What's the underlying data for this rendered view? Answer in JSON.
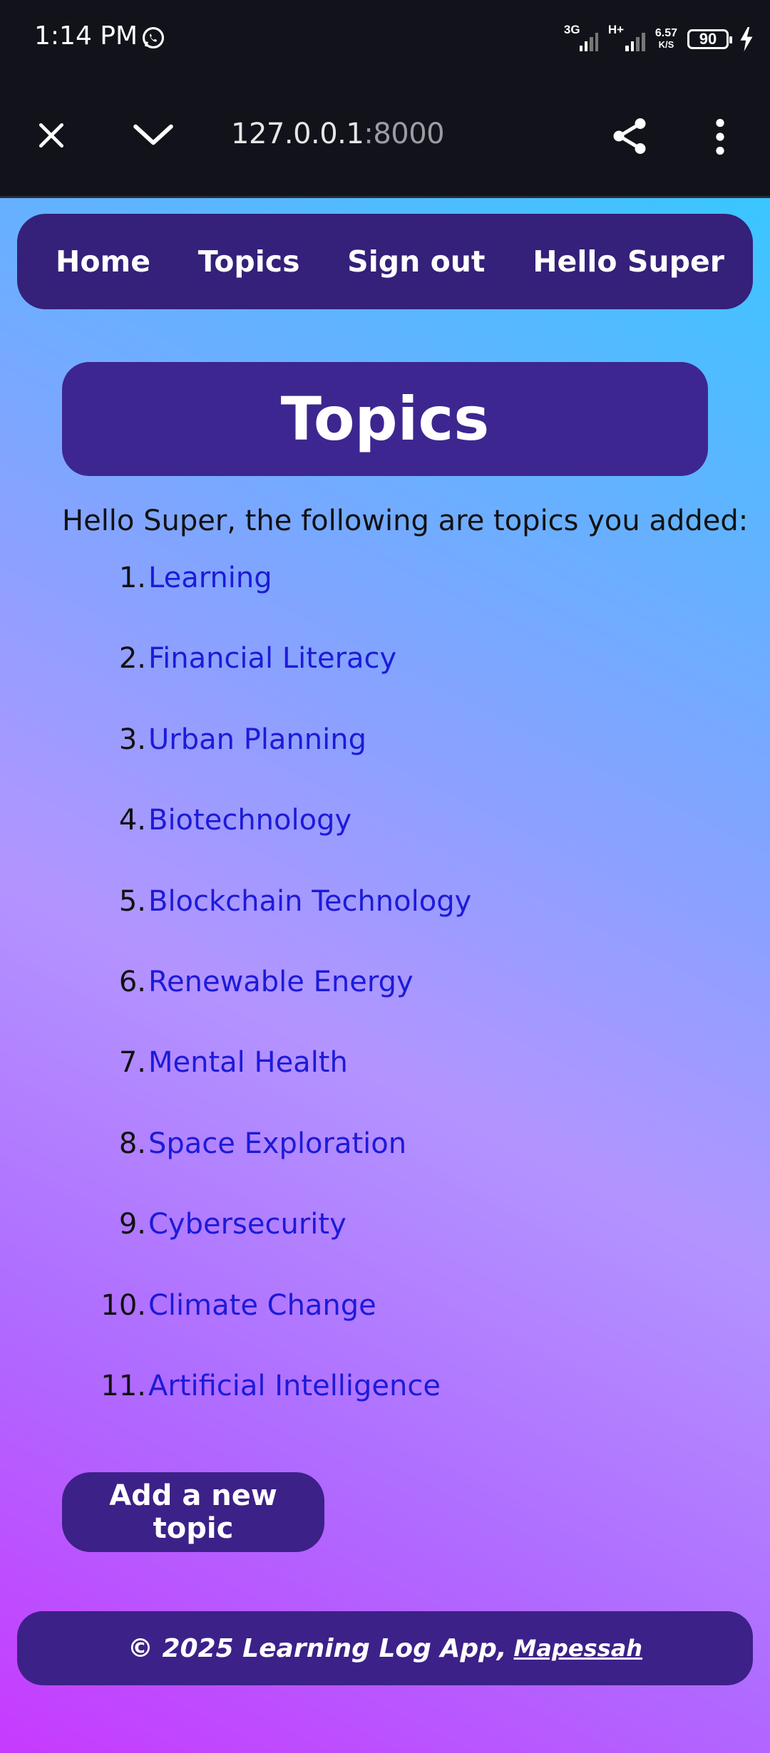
{
  "status_bar": {
    "time": "1:14 PM",
    "network1": "3G",
    "network2": "H+",
    "speed_value": "6.57",
    "speed_unit": "K/S",
    "battery": "90"
  },
  "browser": {
    "url_host": "127.0.0.1",
    "url_port": ":8000"
  },
  "nav": {
    "home": "Home",
    "topics": "Topics",
    "sign_out": "Sign out",
    "greeting": "Hello Super"
  },
  "main": {
    "title": "Topics",
    "intro": "Hello Super, the following are topics you added:",
    "topics": [
      {
        "num": "1.",
        "label": "Learning"
      },
      {
        "num": "2.",
        "label": "Financial Literacy"
      },
      {
        "num": "3.",
        "label": "Urban Planning"
      },
      {
        "num": "4.",
        "label": "Biotechnology"
      },
      {
        "num": "5.",
        "label": "Blockchain Technology"
      },
      {
        "num": "6.",
        "label": "Renewable Energy"
      },
      {
        "num": "7.",
        "label": "Mental Health"
      },
      {
        "num": "8.",
        "label": "Space Exploration"
      },
      {
        "num": "9.",
        "label": "Cybersecurity"
      },
      {
        "num": "10.",
        "label": "Climate Change"
      },
      {
        "num": "11.",
        "label": "Artificial Intelligence"
      }
    ],
    "add_button": "Add a new topic"
  },
  "footer": {
    "text": "© 2025 Learning Log App,",
    "link": "Mapessah"
  },
  "colors": {
    "nav_bg": "#35207a",
    "link": "#1d1ad8",
    "browser_bg": "#12131a"
  }
}
